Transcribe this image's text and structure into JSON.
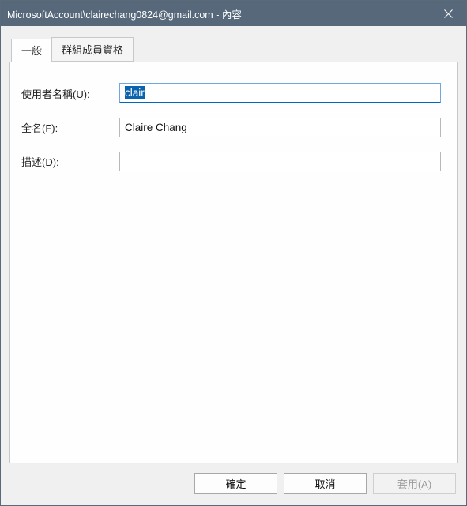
{
  "window": {
    "title": "MicrosoftAccount\\clairechang0824@gmail.com - 內容"
  },
  "tabs": {
    "general": "一般",
    "groups": "群組成員資格"
  },
  "fields": {
    "username_label": "使用者名稱(U):",
    "username_value": "clair",
    "username_selected": "clair",
    "fullname_label": "全名(F):",
    "fullname_value": "Claire Chang",
    "description_label": "描述(D):",
    "description_value": ""
  },
  "buttons": {
    "ok": "確定",
    "cancel": "取消",
    "apply": "套用(A)"
  }
}
